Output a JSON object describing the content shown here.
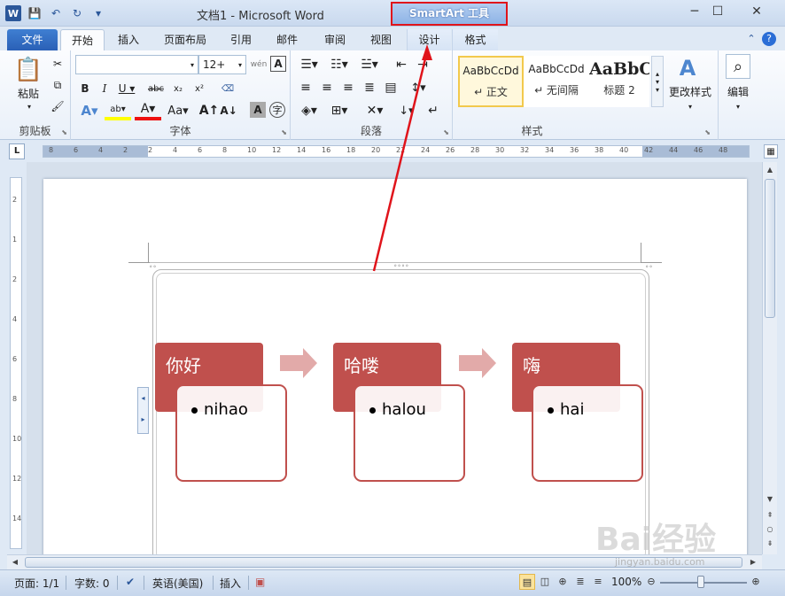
{
  "titlebar": {
    "doc_title": "文档1 - Microsoft Word",
    "context_tools": "SmartArt 工具",
    "minimize": "─",
    "maximize": "☐",
    "close": "✕"
  },
  "tabs": {
    "file": "文件",
    "home": "开始",
    "insert": "插入",
    "page_layout": "页面布局",
    "references": "引用",
    "mailings": "邮件",
    "review": "审阅",
    "view": "视图",
    "design": "设计",
    "format": "格式"
  },
  "ribbon": {
    "clipboard": {
      "label": "剪贴板",
      "paste": "粘贴"
    },
    "font": {
      "label": "字体",
      "font_name": "",
      "font_size": "12+",
      "wen": "wén"
    },
    "paragraph": {
      "label": "段落"
    },
    "styles": {
      "label": "样式",
      "cards": [
        {
          "sample": "AaBbCcDd",
          "name": "↵ 正文"
        },
        {
          "sample": "AaBbCcDd",
          "name": "↵ 无间隔"
        },
        {
          "sample": "AaBbC(",
          "name": "标题 2"
        }
      ],
      "change_styles": "更改样式",
      "editing": "编辑"
    }
  },
  "ruler": {
    "corner": "L",
    "ticks": [
      "8",
      "6",
      "4",
      "2",
      "2",
      "4",
      "6",
      "8",
      "10",
      "12",
      "14",
      "16",
      "18",
      "20",
      "22",
      "24",
      "26",
      "28",
      "30",
      "32",
      "34",
      "36",
      "38",
      "40",
      "42",
      "44",
      "46",
      "48"
    ],
    "vticks": [
      "2",
      "1",
      "2",
      "4",
      "6",
      "8",
      "10",
      "12",
      "14"
    ]
  },
  "smartart": {
    "items": [
      {
        "title": "你好",
        "bullet": "nihao"
      },
      {
        "title": "哈喽",
        "bullet": "halou"
      },
      {
        "title": "嗨",
        "bullet": "hai"
      }
    ],
    "color_primary": "#c0504d",
    "color_arrow": "#e2aaa9"
  },
  "statusbar": {
    "page": "页面: 1/1",
    "words": "字数: 0",
    "language": "英语(美国)",
    "mode": "插入",
    "zoom": "100%"
  },
  "watermark": {
    "brand": "Bai经验",
    "url": "jingyan.baidu.com"
  },
  "colors": {
    "annotation": "#e0141b",
    "accent": "#2b579a"
  }
}
